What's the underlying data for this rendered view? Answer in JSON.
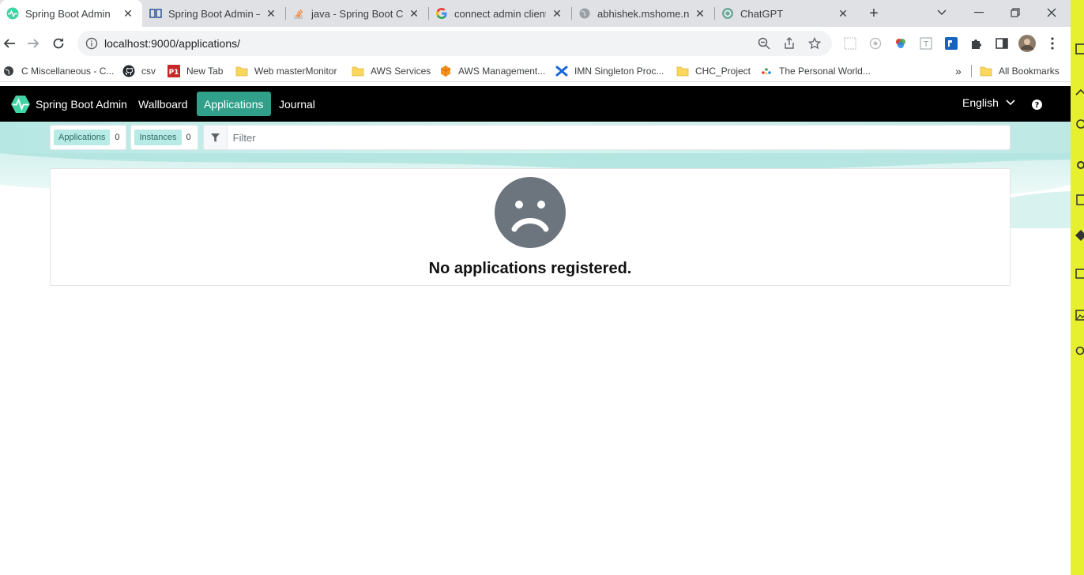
{
  "browser": {
    "tabs": [
      {
        "title": "Spring Boot Admin",
        "active": true,
        "icon": "spring-boot-admin-icon"
      },
      {
        "title": "Spring Boot Admin –",
        "active": false,
        "icon": "book-icon"
      },
      {
        "title": "java - Spring Boot Cli",
        "active": false,
        "icon": "stackoverflow-icon"
      },
      {
        "title": "connect admin client",
        "active": false,
        "icon": "google-icon"
      },
      {
        "title": "abhishek.mshome.ne",
        "active": false,
        "icon": "globe-icon"
      },
      {
        "title": "ChatGPT",
        "active": false,
        "icon": "chatgpt-icon"
      }
    ],
    "url": "localhost:9000/applications/",
    "bookmarks": [
      {
        "label": "C Miscellaneous - C...",
        "icon": "globe-icon"
      },
      {
        "label": "csv",
        "icon": "github-icon"
      },
      {
        "label": "New Tab",
        "icon": "p1-icon"
      },
      {
        "label": "Web masterMonitor",
        "icon": "folder-icon"
      },
      {
        "label": "AWS Services",
        "icon": "folder-icon"
      },
      {
        "label": "AWS Management...",
        "icon": "aws-icon"
      },
      {
        "label": "IMN Singleton Proc...",
        "icon": "confluence-icon"
      },
      {
        "label": "CHC_Project",
        "icon": "folder-icon"
      },
      {
        "label": "The Personal World...",
        "icon": "dots-icon"
      }
    ],
    "all_bookmarks": "All Bookmarks",
    "more_bookmarks": "»"
  },
  "app": {
    "brand": "Spring Boot Admin",
    "nav": [
      {
        "label": "Wallboard",
        "active": false
      },
      {
        "label": "Applications",
        "active": true
      },
      {
        "label": "Journal",
        "active": false
      }
    ],
    "language": "English"
  },
  "filter": {
    "applications_label": "Applications",
    "applications_count": "0",
    "instances_label": "Instances",
    "instances_count": "0",
    "placeholder": "Filter"
  },
  "empty_state": {
    "message": "No applications registered."
  },
  "colors": {
    "navbar": "#000000",
    "accent": "#31a08a",
    "chip": "#b9ebe6",
    "side_panel": "#e7f02f"
  }
}
